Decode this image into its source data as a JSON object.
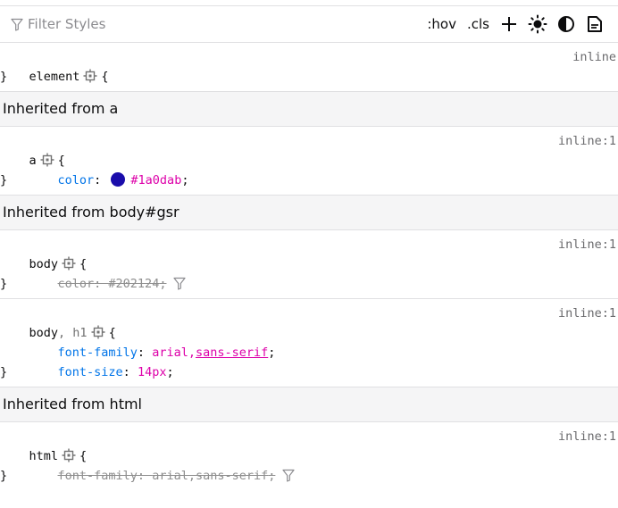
{
  "toolbar": {
    "filter_placeholder": "Filter Styles",
    "hov_label": ":hov",
    "cls_label": ".cls"
  },
  "rules": [
    {
      "selector": "element",
      "source": "inline",
      "declarations": []
    },
    {
      "selector": "a",
      "source": "inline:1",
      "declarations": [
        {
          "prop": "color",
          "value": "#1a0dab",
          "swatch": "#1a0dab",
          "overridden": false
        }
      ]
    },
    {
      "selector": "body",
      "source": "inline:1",
      "declarations": [
        {
          "prop": "color",
          "value": "#202124",
          "overridden": true
        }
      ]
    },
    {
      "selector_main": "body",
      "selector_sep": ", ",
      "selector_dim": "h1",
      "source": "inline:1",
      "declarations": [
        {
          "prop": "font-family",
          "value_a": "arial,",
          "value_b": "sans-serif"
        },
        {
          "prop": "font-size",
          "value": "14px"
        }
      ]
    },
    {
      "selector": "html",
      "source": "inline:1",
      "declarations": [
        {
          "prop": "font-family",
          "value": "arial,sans-serif",
          "overridden": true
        }
      ]
    }
  ],
  "inherited_headers": [
    "Inherited from a",
    "Inherited from body#gsr",
    "Inherited from html"
  ],
  "colors": {
    "property": "#0074e8",
    "value": "#dd00a9",
    "swatch": "#1a0dab"
  }
}
